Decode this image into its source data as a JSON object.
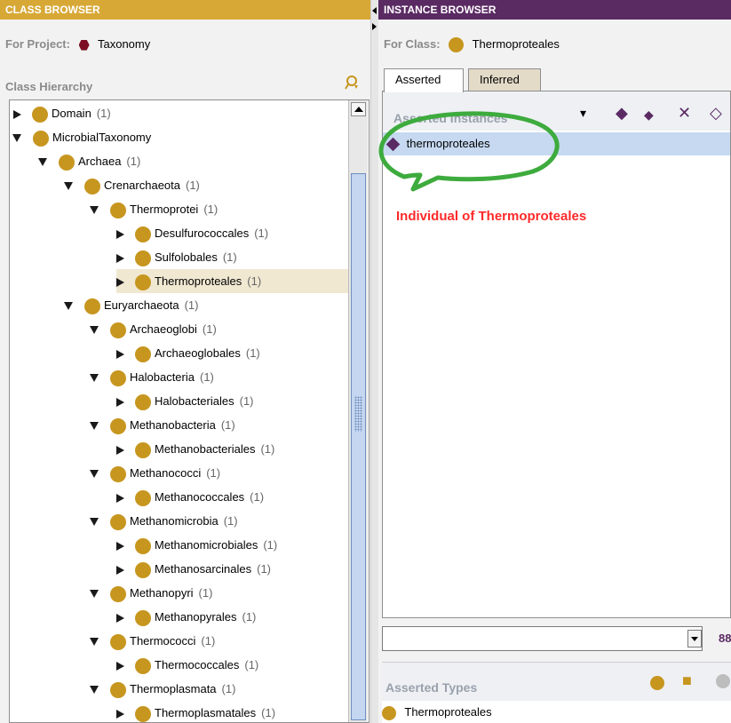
{
  "class_browser": {
    "title": "CLASS BROWSER",
    "project_label": "For Project:",
    "project_name": "Taxonomy",
    "hierarchy_label": "Class Hierarchy",
    "tree": [
      {
        "label": "Domain",
        "count": "(1)",
        "state": "collapsed",
        "depth": 0
      },
      {
        "label": "MicrobialTaxonomy",
        "count": "",
        "state": "expanded",
        "depth": 0
      },
      {
        "label": "Archaea",
        "count": "(1)",
        "state": "expanded",
        "depth": 1
      },
      {
        "label": "Crenarchaeota",
        "count": "(1)",
        "state": "expanded",
        "depth": 2
      },
      {
        "label": "Thermoprotei",
        "count": "(1)",
        "state": "expanded",
        "depth": 3
      },
      {
        "label": "Desulfurococcales",
        "count": "(1)",
        "state": "collapsed",
        "depth": 4
      },
      {
        "label": "Sulfolobales",
        "count": "(1)",
        "state": "collapsed",
        "depth": 4
      },
      {
        "label": "Thermoproteales",
        "count": "(1)",
        "state": "collapsed",
        "depth": 4,
        "selected": true
      },
      {
        "label": "Euryarchaeota",
        "count": "(1)",
        "state": "expanded",
        "depth": 2
      },
      {
        "label": "Archaeoglobi",
        "count": "(1)",
        "state": "expanded",
        "depth": 3
      },
      {
        "label": "Archaeoglobales",
        "count": "(1)",
        "state": "collapsed",
        "depth": 4
      },
      {
        "label": "Halobacteria",
        "count": "(1)",
        "state": "expanded",
        "depth": 3
      },
      {
        "label": "Halobacteriales",
        "count": "(1)",
        "state": "collapsed",
        "depth": 4
      },
      {
        "label": "Methanobacteria",
        "count": "(1)",
        "state": "expanded",
        "depth": 3
      },
      {
        "label": "Methanobacteriales",
        "count": "(1)",
        "state": "collapsed",
        "depth": 4
      },
      {
        "label": "Methanococci",
        "count": "(1)",
        "state": "expanded",
        "depth": 3
      },
      {
        "label": "Methanococcales",
        "count": "(1)",
        "state": "collapsed",
        "depth": 4
      },
      {
        "label": "Methanomicrobia",
        "count": "(1)",
        "state": "expanded",
        "depth": 3
      },
      {
        "label": "Methanomicrobiales",
        "count": "(1)",
        "state": "collapsed",
        "depth": 4
      },
      {
        "label": "Methanosarcinales",
        "count": "(1)",
        "state": "collapsed",
        "depth": 4
      },
      {
        "label": "Methanopyri",
        "count": "(1)",
        "state": "expanded",
        "depth": 3
      },
      {
        "label": "Methanopyrales",
        "count": "(1)",
        "state": "collapsed",
        "depth": 4
      },
      {
        "label": "Thermococci",
        "count": "(1)",
        "state": "expanded",
        "depth": 3
      },
      {
        "label": "Thermococcales",
        "count": "(1)",
        "state": "collapsed",
        "depth": 4
      },
      {
        "label": "Thermoplasmata",
        "count": "(1)",
        "state": "expanded",
        "depth": 3
      },
      {
        "label": "Thermoplasmatales",
        "count": "(1)",
        "state": "collapsed",
        "depth": 4
      }
    ]
  },
  "instance_browser": {
    "title": "INSTANCE BROWSER",
    "class_label": "For Class:",
    "class_name": "Thermoproteales",
    "tabs": [
      {
        "label": "Asserted",
        "active": true
      },
      {
        "label": "Inferred",
        "active": false
      }
    ],
    "instances_label": "Asserted Instances",
    "instances": [
      "thermoproteales"
    ],
    "annotation": "Individual of Thermoproteales",
    "types_label": "Asserted Types",
    "types": [
      "Thermoproteales"
    ]
  },
  "colors": {
    "class_header": "#d8a836",
    "instance_header": "#5a2a63",
    "class_dot": "#c7961f",
    "selection": "#c6d9f1",
    "annotation": "#ff2a2a",
    "highlight_ellipse": "#3dab3d"
  }
}
